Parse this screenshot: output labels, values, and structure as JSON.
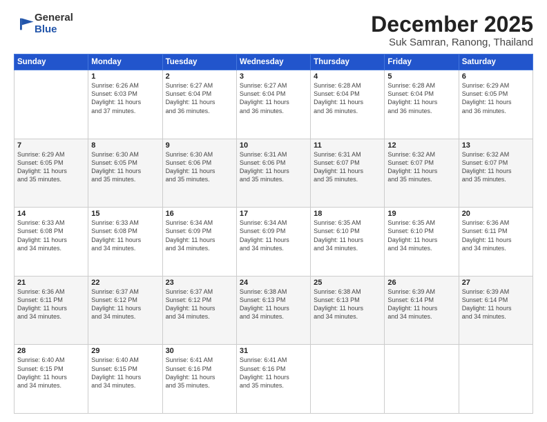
{
  "header": {
    "logo_general": "General",
    "logo_blue": "Blue",
    "main_title": "December 2025",
    "subtitle": "Suk Samran, Ranong, Thailand"
  },
  "days_of_week": [
    "Sunday",
    "Monday",
    "Tuesday",
    "Wednesday",
    "Thursday",
    "Friday",
    "Saturday"
  ],
  "weeks": [
    [
      {
        "day": "",
        "info": ""
      },
      {
        "day": "1",
        "info": "Sunrise: 6:26 AM\nSunset: 6:03 PM\nDaylight: 11 hours\nand 37 minutes."
      },
      {
        "day": "2",
        "info": "Sunrise: 6:27 AM\nSunset: 6:04 PM\nDaylight: 11 hours\nand 36 minutes."
      },
      {
        "day": "3",
        "info": "Sunrise: 6:27 AM\nSunset: 6:04 PM\nDaylight: 11 hours\nand 36 minutes."
      },
      {
        "day": "4",
        "info": "Sunrise: 6:28 AM\nSunset: 6:04 PM\nDaylight: 11 hours\nand 36 minutes."
      },
      {
        "day": "5",
        "info": "Sunrise: 6:28 AM\nSunset: 6:04 PM\nDaylight: 11 hours\nand 36 minutes."
      },
      {
        "day": "6",
        "info": "Sunrise: 6:29 AM\nSunset: 6:05 PM\nDaylight: 11 hours\nand 36 minutes."
      }
    ],
    [
      {
        "day": "7",
        "info": "Sunrise: 6:29 AM\nSunset: 6:05 PM\nDaylight: 11 hours\nand 35 minutes."
      },
      {
        "day": "8",
        "info": "Sunrise: 6:30 AM\nSunset: 6:05 PM\nDaylight: 11 hours\nand 35 minutes."
      },
      {
        "day": "9",
        "info": "Sunrise: 6:30 AM\nSunset: 6:06 PM\nDaylight: 11 hours\nand 35 minutes."
      },
      {
        "day": "10",
        "info": "Sunrise: 6:31 AM\nSunset: 6:06 PM\nDaylight: 11 hours\nand 35 minutes."
      },
      {
        "day": "11",
        "info": "Sunrise: 6:31 AM\nSunset: 6:07 PM\nDaylight: 11 hours\nand 35 minutes."
      },
      {
        "day": "12",
        "info": "Sunrise: 6:32 AM\nSunset: 6:07 PM\nDaylight: 11 hours\nand 35 minutes."
      },
      {
        "day": "13",
        "info": "Sunrise: 6:32 AM\nSunset: 6:07 PM\nDaylight: 11 hours\nand 35 minutes."
      }
    ],
    [
      {
        "day": "14",
        "info": "Sunrise: 6:33 AM\nSunset: 6:08 PM\nDaylight: 11 hours\nand 34 minutes."
      },
      {
        "day": "15",
        "info": "Sunrise: 6:33 AM\nSunset: 6:08 PM\nDaylight: 11 hours\nand 34 minutes."
      },
      {
        "day": "16",
        "info": "Sunrise: 6:34 AM\nSunset: 6:09 PM\nDaylight: 11 hours\nand 34 minutes."
      },
      {
        "day": "17",
        "info": "Sunrise: 6:34 AM\nSunset: 6:09 PM\nDaylight: 11 hours\nand 34 minutes."
      },
      {
        "day": "18",
        "info": "Sunrise: 6:35 AM\nSunset: 6:10 PM\nDaylight: 11 hours\nand 34 minutes."
      },
      {
        "day": "19",
        "info": "Sunrise: 6:35 AM\nSunset: 6:10 PM\nDaylight: 11 hours\nand 34 minutes."
      },
      {
        "day": "20",
        "info": "Sunrise: 6:36 AM\nSunset: 6:11 PM\nDaylight: 11 hours\nand 34 minutes."
      }
    ],
    [
      {
        "day": "21",
        "info": "Sunrise: 6:36 AM\nSunset: 6:11 PM\nDaylight: 11 hours\nand 34 minutes."
      },
      {
        "day": "22",
        "info": "Sunrise: 6:37 AM\nSunset: 6:12 PM\nDaylight: 11 hours\nand 34 minutes."
      },
      {
        "day": "23",
        "info": "Sunrise: 6:37 AM\nSunset: 6:12 PM\nDaylight: 11 hours\nand 34 minutes."
      },
      {
        "day": "24",
        "info": "Sunrise: 6:38 AM\nSunset: 6:13 PM\nDaylight: 11 hours\nand 34 minutes."
      },
      {
        "day": "25",
        "info": "Sunrise: 6:38 AM\nSunset: 6:13 PM\nDaylight: 11 hours\nand 34 minutes."
      },
      {
        "day": "26",
        "info": "Sunrise: 6:39 AM\nSunset: 6:14 PM\nDaylight: 11 hours\nand 34 minutes."
      },
      {
        "day": "27",
        "info": "Sunrise: 6:39 AM\nSunset: 6:14 PM\nDaylight: 11 hours\nand 34 minutes."
      }
    ],
    [
      {
        "day": "28",
        "info": "Sunrise: 6:40 AM\nSunset: 6:15 PM\nDaylight: 11 hours\nand 34 minutes."
      },
      {
        "day": "29",
        "info": "Sunrise: 6:40 AM\nSunset: 6:15 PM\nDaylight: 11 hours\nand 34 minutes."
      },
      {
        "day": "30",
        "info": "Sunrise: 6:41 AM\nSunset: 6:16 PM\nDaylight: 11 hours\nand 35 minutes."
      },
      {
        "day": "31",
        "info": "Sunrise: 6:41 AM\nSunset: 6:16 PM\nDaylight: 11 hours\nand 35 minutes."
      },
      {
        "day": "",
        "info": ""
      },
      {
        "day": "",
        "info": ""
      },
      {
        "day": "",
        "info": ""
      }
    ]
  ]
}
